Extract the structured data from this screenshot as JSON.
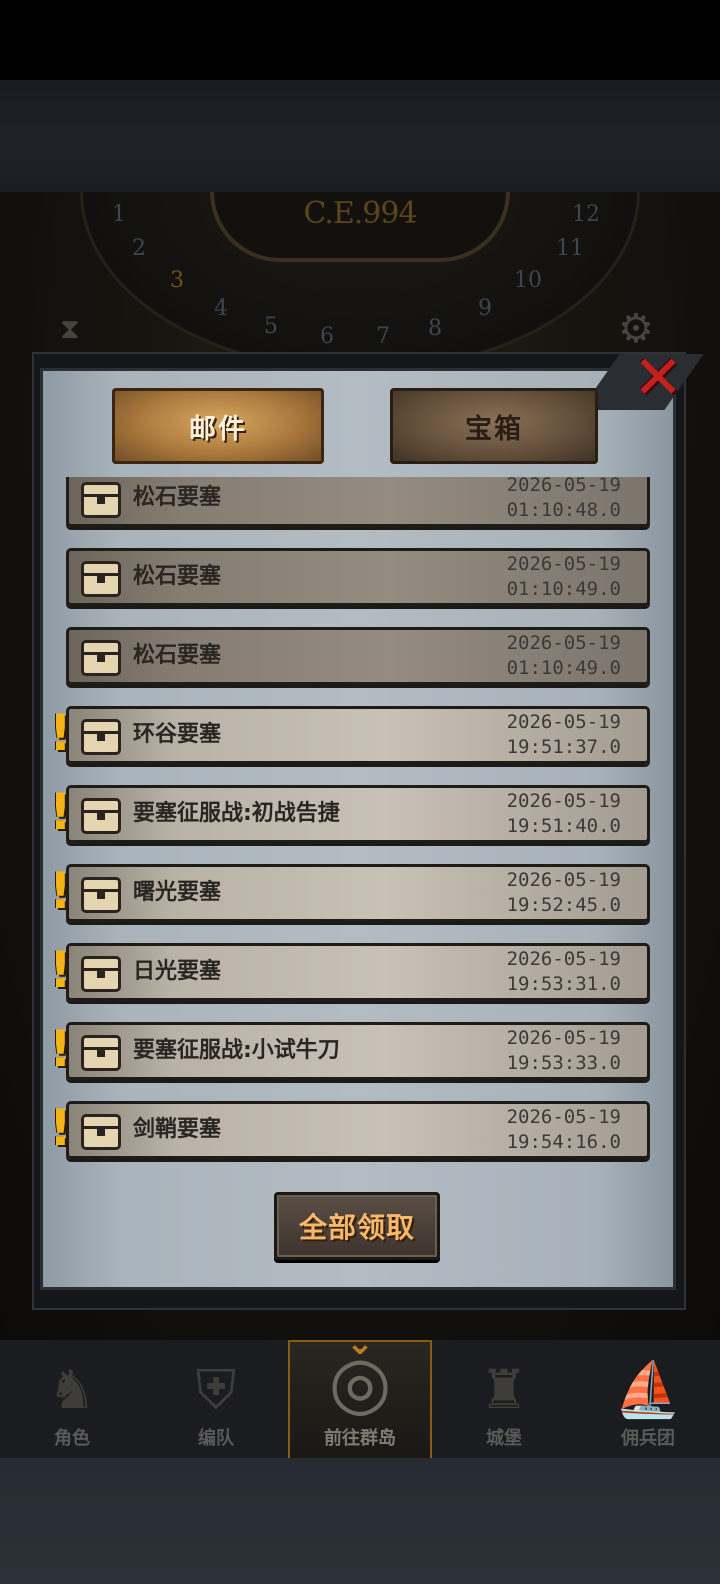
{
  "world": {
    "era": "C.E.994",
    "dial_numbers": [
      "1",
      "2",
      "3",
      "4",
      "5",
      "6",
      "7",
      "8",
      "9",
      "10",
      "11",
      "12"
    ]
  },
  "bottom_nav": [
    {
      "label": "角色",
      "icon": "knight-icon"
    },
    {
      "label": "编队",
      "icon": "helmet-icon"
    },
    {
      "label": "前往群岛",
      "icon": "world-map-icon",
      "active": true
    },
    {
      "label": "城堡",
      "icon": "castle-icon"
    },
    {
      "label": "佣兵团",
      "icon": "ship-icon"
    }
  ],
  "mailbox": {
    "tabs": [
      {
        "label": "邮件",
        "active": true
      },
      {
        "label": "宝箱",
        "active": false
      }
    ],
    "close_icon": "close-x-icon",
    "items": [
      {
        "title": "松石要塞",
        "date": "2026-05-19",
        "time": "01:10:48.0",
        "unread": false
      },
      {
        "title": "松石要塞",
        "date": "2026-05-19",
        "time": "01:10:49.0",
        "unread": false
      },
      {
        "title": "松石要塞",
        "date": "2026-05-19",
        "time": "01:10:49.0",
        "unread": false
      },
      {
        "title": "环谷要塞",
        "date": "2026-05-19",
        "time": "19:51:37.0",
        "unread": true
      },
      {
        "title": "要塞征服战:初战告捷",
        "date": "2026-05-19",
        "time": "19:51:40.0",
        "unread": true
      },
      {
        "title": "曙光要塞",
        "date": "2026-05-19",
        "time": "19:52:45.0",
        "unread": true
      },
      {
        "title": "日光要塞",
        "date": "2026-05-19",
        "time": "19:53:31.0",
        "unread": true
      },
      {
        "title": "要塞征服战:小试牛刀",
        "date": "2026-05-19",
        "time": "19:53:33.0",
        "unread": true
      },
      {
        "title": "剑鞘要塞",
        "date": "2026-05-19",
        "time": "19:54:16.0",
        "unread": true
      }
    ],
    "claim_all_label": "全部领取",
    "accent": "#f2b417",
    "close_color": "#c3201e"
  }
}
